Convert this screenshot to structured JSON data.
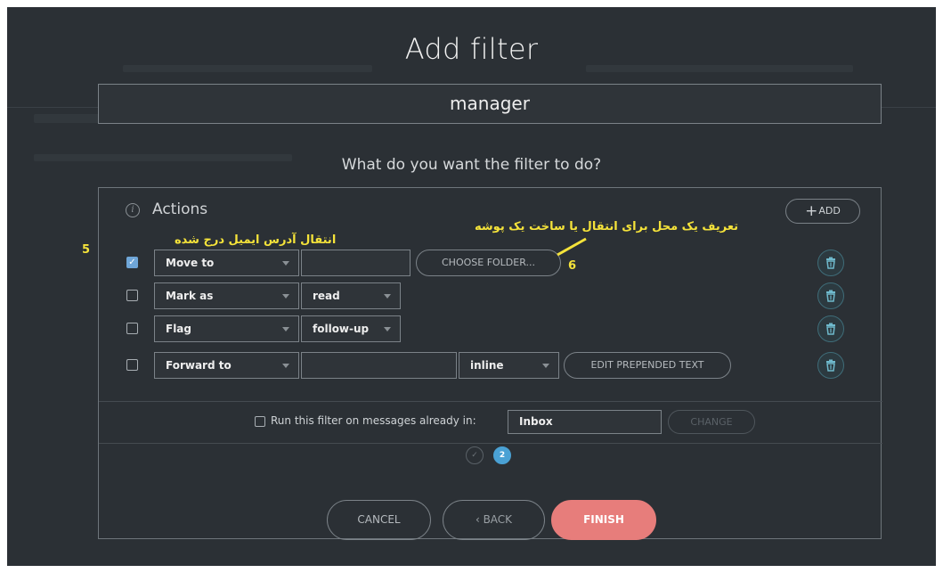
{
  "dialog": {
    "title": "Add filter",
    "filter_name": "manager",
    "question": "What do you want the filter to do?"
  },
  "actions": {
    "header": "Actions",
    "add_label": "ADD",
    "rows": [
      {
        "checked": true,
        "action": "Move to",
        "folder_value": "",
        "button": "CHOOSE FOLDER..."
      },
      {
        "checked": false,
        "action": "Mark as",
        "value": "read"
      },
      {
        "checked": false,
        "action": "Flag",
        "value": "follow-up"
      },
      {
        "checked": false,
        "action": "Forward to",
        "address_value": "",
        "mode": "inline",
        "button": "EDIT PREPENDED TEXT"
      }
    ]
  },
  "run_filter": {
    "checked": false,
    "label": "Run this filter on messages already in:",
    "folder": "Inbox",
    "change_label": "CHANGE"
  },
  "steps": {
    "step1": "✓",
    "step2": "2"
  },
  "footer": {
    "cancel_label": "CANCEL",
    "back_label": "‹ BACK",
    "finish_label": "FINISH"
  },
  "annotations": {
    "note5_text": "انتقال آدرس ایمیل درج شده",
    "note5_number": "5",
    "note6_text": "تعریف یک محل برای انتقال یا ساخت یک پوشه",
    "note6_number": "6"
  },
  "colors": {
    "background": "#2b3035",
    "accent_blue": "#4aa1d4",
    "finish_red": "#e77d7b",
    "annotation_yellow": "#f5e33a",
    "trash_teal": "#6fb9cc"
  },
  "icons": [
    "info-icon",
    "plus-icon",
    "checkbox-checked-icon",
    "caret-down-icon",
    "trash-icon",
    "check-icon"
  ]
}
